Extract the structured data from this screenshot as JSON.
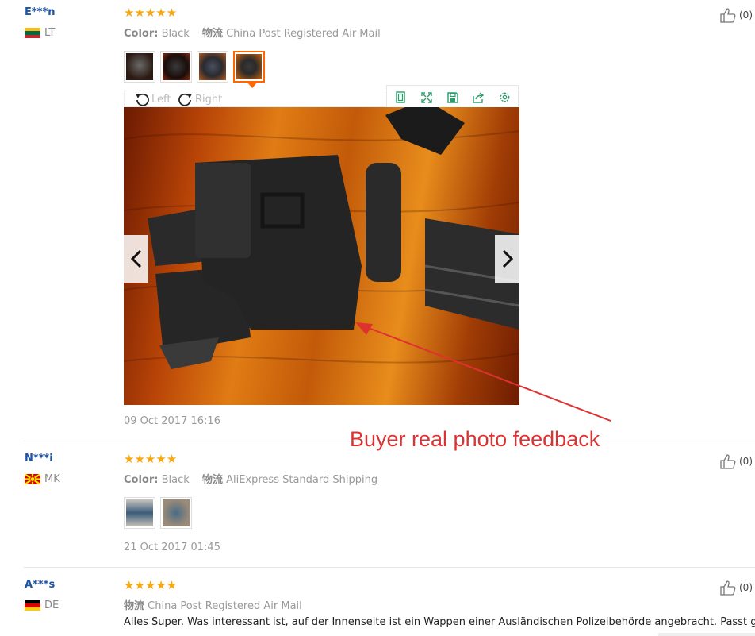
{
  "reviews": [
    {
      "user": "E***n",
      "country": "LT",
      "stars": "★★★★★",
      "color_label": "Color:",
      "color_value": "Black",
      "shipping_label": "物流",
      "shipping_value": "China Post Registered Air Mail",
      "date": "09 Oct 2017 16:16",
      "helpful_count": "(0)"
    },
    {
      "user": "N***i",
      "country": "MK",
      "stars": "★★★★★",
      "color_label": "Color:",
      "color_value": "Black",
      "shipping_label": "物流",
      "shipping_value": "AliExpress Standard Shipping",
      "date": "21 Oct 2017 01:45",
      "helpful_count": "(0)"
    },
    {
      "user": "A***s",
      "country": "DE",
      "stars": "★★★★★",
      "shipping_label": "物流",
      "shipping_value": "China Post Registered Air Mail",
      "text": "Alles Super. Was interessant ist, auf der Innenseite ist ein Wappen einer Ausländischen Polizeibehörde angebracht. Passt gut.",
      "helpful_count": "(0)"
    }
  ],
  "viewer": {
    "rotate_left": "Left",
    "rotate_right": "Right",
    "tools": [
      "fit-icon",
      "fullscreen-icon",
      "save-icon",
      "share-icon",
      "settings-icon"
    ]
  },
  "annotation": "Buyer real photo feedback",
  "colors": {
    "accent": "#f60",
    "star": "#f8a70f",
    "username": "#1d55a6",
    "tool_icon": "#2a9d6a",
    "annotation": "#e03131"
  }
}
